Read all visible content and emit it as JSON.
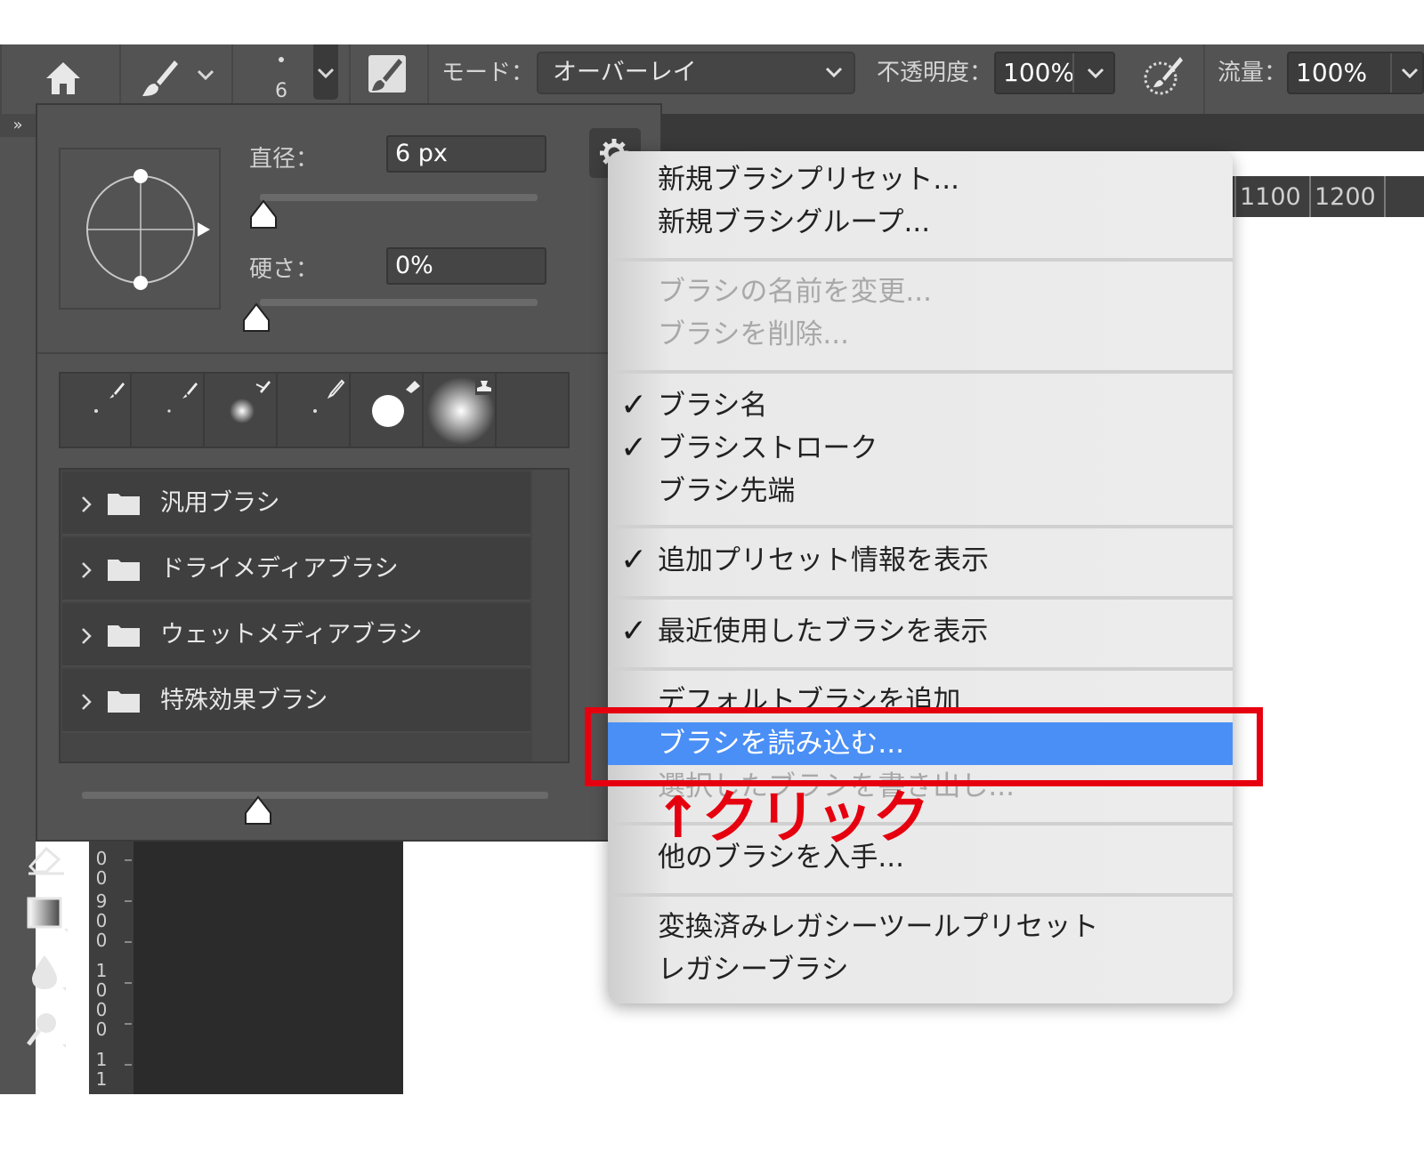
{
  "options_bar": {
    "brush_size_value": "6",
    "mode_label": "モード：",
    "mode_value": "オーバーレイ",
    "opacity_label": "不透明度：",
    "opacity_value": "100%",
    "flow_label": "流量：",
    "flow_value": "100%"
  },
  "brush_panel": {
    "diameter_label": "直径：",
    "diameter_value": "6 px",
    "hardness_label": "硬さ：",
    "hardness_value": "0%",
    "diameter_fraction": 0.0,
    "hardness_fraction": 0.0,
    "preset_groups": [
      {
        "label": "汎用ブラシ"
      },
      {
        "label": "ドライメディアブラシ"
      },
      {
        "label": "ウェットメディアブラシ"
      },
      {
        "label": "特殊効果ブラシ"
      }
    ]
  },
  "collapse_label": "»",
  "ruler_h": [
    "1100",
    "1200"
  ],
  "ruler_v": [
    "0",
    "0",
    "9",
    "0",
    "0",
    "1",
    "0",
    "0",
    "0",
    "1",
    "1"
  ],
  "context_menu": {
    "items": [
      {
        "label": "新規ブラシプリセット...",
        "checked": false,
        "disabled": false
      },
      {
        "label": "新規ブラシグループ...",
        "checked": false,
        "disabled": false
      },
      {
        "label": "ブラシの名前を変更...",
        "checked": false,
        "disabled": true
      },
      {
        "label": "ブラシを削除...",
        "checked": false,
        "disabled": true
      },
      {
        "label": "ブラシ名",
        "checked": true,
        "disabled": false
      },
      {
        "label": "ブラシストローク",
        "checked": true,
        "disabled": false
      },
      {
        "label": "ブラシ先端",
        "checked": false,
        "disabled": false
      },
      {
        "label": "追加プリセット情報を表示",
        "checked": true,
        "disabled": false
      },
      {
        "label": "最近使用したブラシを表示",
        "checked": true,
        "disabled": false
      },
      {
        "label": "デフォルトブラシを追加",
        "checked": false,
        "disabled": false
      },
      {
        "label": "ブラシを読み込む...",
        "checked": false,
        "disabled": false,
        "selected": true
      },
      {
        "label": "選択したブラシを書き出し...",
        "checked": false,
        "disabled": true
      },
      {
        "label": "他のブラシを入手...",
        "checked": false,
        "disabled": false
      },
      {
        "label": "変換済みレガシーツールプリセット",
        "checked": false,
        "disabled": false
      },
      {
        "label": "レガシーブラシ",
        "checked": false,
        "disabled": false
      }
    ],
    "check_mark": "✓"
  },
  "annotation": {
    "caption": "↑クリック",
    "color": "#e6000f"
  },
  "colors": {
    "selection_blue": "#4a8ff5",
    "ui_gray": "#535353"
  }
}
